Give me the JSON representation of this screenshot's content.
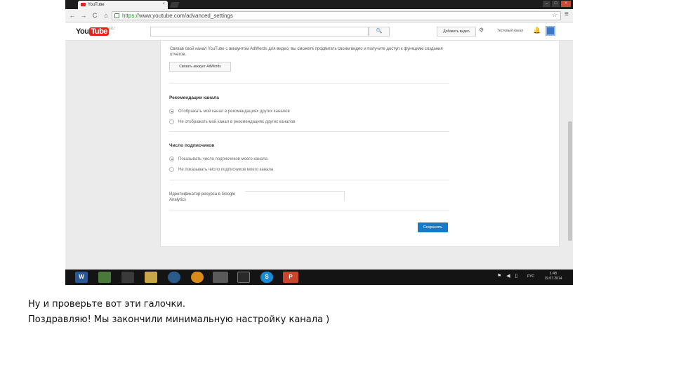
{
  "browser": {
    "tab_title": "YouTube",
    "tab_close": "×",
    "window_buttons": [
      "–",
      "□",
      "×"
    ],
    "nav": {
      "back": "←",
      "forward": "→",
      "reload": "C",
      "home": "⌂"
    },
    "url_scheme": "https://",
    "url_rest": "www.youtube.com/advanced_settings",
    "star": "☆",
    "menu": "≡"
  },
  "masthead": {
    "logo_you": "You",
    "logo_tube": "Tube",
    "logo_region": "RU",
    "search_placeholder": "",
    "search_icon": "🔍",
    "add_video_label": "Добавить видео",
    "gear": "⚙",
    "channel_name": "Тестовый канал",
    "bell": "🔔"
  },
  "content": {
    "adwords_text": "Связав свой канал YouTube с аккаунтом AdWords для видео, вы сможете продвигать своим видео и получите доступ к функциям создания отчетов.",
    "link_adwords_button": "Связать аккаунт AdWords",
    "recommendations": {
      "title": "Рекомендации канала",
      "options": [
        {
          "label": "Отображать мой канал в рекомендациях других каналов",
          "checked": true
        },
        {
          "label": "Не отображать мой канал в рекомендациях других каналов",
          "checked": false
        }
      ]
    },
    "subscribers": {
      "title": "Число подписчиков",
      "options": [
        {
          "label": "Показывать число подписчиков моего канала",
          "checked": true
        },
        {
          "label": "Не показывать число подписчиков моего канала",
          "checked": false
        }
      ]
    },
    "analytics_label": "Идентификатор ресурса в Google Analytics",
    "save_button": "Сохранить"
  },
  "taskbar": {
    "apps": [
      "W",
      "",
      "",
      "",
      "",
      "",
      "",
      "",
      "S",
      "P"
    ],
    "lang": "РУС",
    "time": "1:48",
    "date": "19.07.2014"
  },
  "captions": {
    "line1": "Ну и проверьте вот эти галочки.",
    "line2": "Поздравляю! Мы закончили минимальную настройку канала )"
  }
}
